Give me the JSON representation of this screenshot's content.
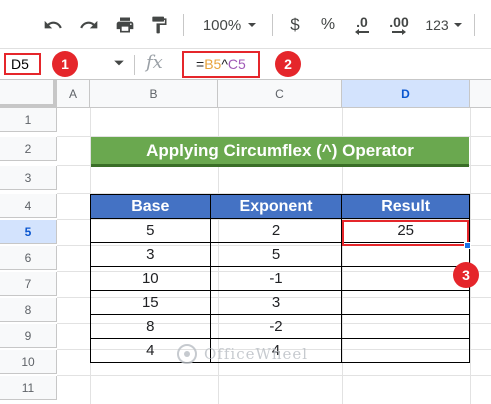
{
  "toolbar": {
    "zoom": "100%",
    "currency_symbol": "$",
    "percent_symbol": "%",
    "decrease_decimal": ".0",
    "increase_decimal": ".00",
    "more_formats": "123"
  },
  "formula_bar": {
    "name_box": "D5",
    "fx_label": "fx",
    "formula": {
      "prefix": "=",
      "ref1": "B5",
      "operator": "^",
      "ref2": "C5"
    }
  },
  "callouts": [
    "1",
    "2",
    "3"
  ],
  "grid": {
    "columns": [
      "A",
      "B",
      "C",
      "D"
    ],
    "selected_column": "D",
    "rows": [
      "1",
      "2",
      "3",
      "4",
      "5",
      "6",
      "7",
      "8",
      "9",
      "10",
      "11"
    ],
    "selected_row": "5"
  },
  "banner": {
    "title": "Applying Circumflex (^) Operator"
  },
  "table": {
    "headers": [
      "Base",
      "Exponent",
      "Result"
    ],
    "rows": [
      [
        "5",
        "2",
        "25"
      ],
      [
        "3",
        "5",
        ""
      ],
      [
        "10",
        "-1",
        ""
      ],
      [
        "15",
        "3",
        ""
      ],
      [
        "8",
        "-2",
        ""
      ],
      [
        "4",
        "4",
        ""
      ]
    ]
  },
  "watermark": {
    "text": "OfficeWheel"
  },
  "colors": {
    "banner_green": "#6aa84f",
    "header_blue": "#4472c4",
    "callout_red": "#e5262b",
    "selection_blue": "#d3e3fd"
  }
}
